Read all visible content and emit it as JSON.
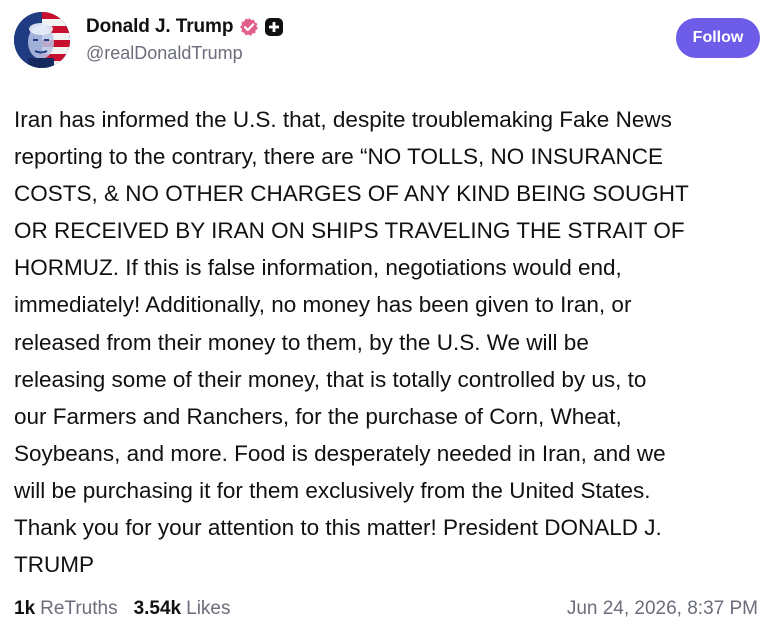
{
  "author": {
    "display_name": "Donald J. Trump",
    "handle": "@realDonaldTrump",
    "avatar_icon": "profile-avatar-flag",
    "verified_icon": "verified-badge-icon",
    "verified_color": "#e0608a",
    "plus_icon": "plus-badge-icon"
  },
  "follow_button": {
    "label": "Follow",
    "color": "#6c5ce7"
  },
  "post": {
    "text": "Iran has informed the U.S. that, despite troublemaking Fake News\nreporting to the contrary, there are “NO TOLLS, NO INSURANCE\nCOSTS, & NO OTHER CHARGES OF ANY KIND BEING SOUGHT\nOR RECEIVED BY IRAN ON SHIPS TRAVELING THE STRAIT OF\nHORMUZ. If this is false information, negotiations would end,\nimmediately! Additionally, no money has been given to Iran, or\nreleased from their money to them, by the U.S. We will be\nreleasing some of their money, that is totally controlled by us, to\nour Farmers and Ranchers, for the purchase of Corn, Wheat,\nSoybeans, and more. Food is desperately needed in Iran, and we\nwill be purchasing it for them exclusively from the United States.\nThank you for your attention to this matter! President DONALD J.\nTRUMP"
  },
  "stats": {
    "retruths_count": "1k",
    "retruths_label": "ReTruths",
    "likes_count": "3.54k",
    "likes_label": "Likes"
  },
  "timestamp": "Jun 24, 2026, 8:37 PM"
}
